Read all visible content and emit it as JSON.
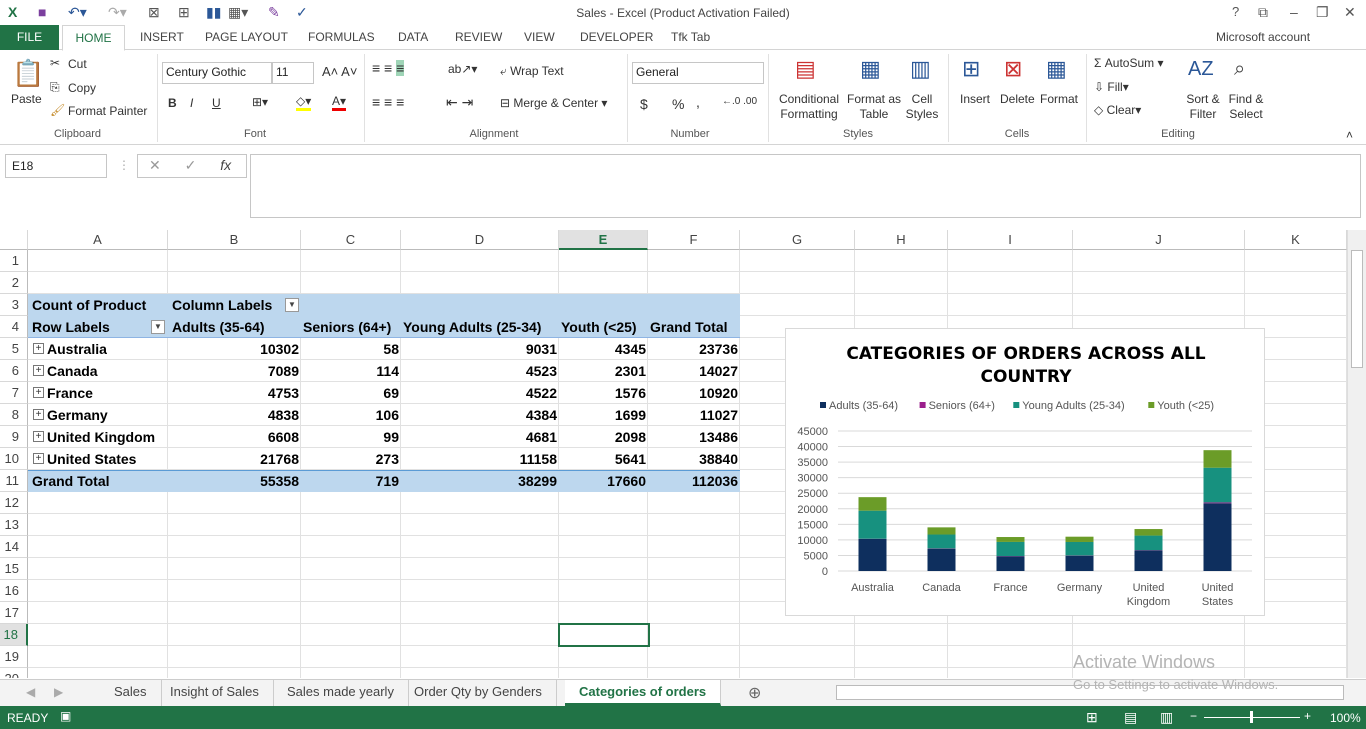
{
  "window": {
    "title": "Sales - Excel (Product Activation Failed)",
    "help": "?",
    "account": "Microsoft account"
  },
  "ribbon_tabs": [
    "FILE",
    "HOME",
    "INSERT",
    "PAGE LAYOUT",
    "FORMULAS",
    "DATA",
    "REVIEW",
    "VIEW",
    "DEVELOPER",
    "Tfk Tab"
  ],
  "ribbon": {
    "clipboard": {
      "paste": "Paste",
      "cut": "Cut",
      "copy": "Copy",
      "format_painter": "Format Painter",
      "label": "Clipboard"
    },
    "font": {
      "name": "Century Gothic",
      "size": "11",
      "bold": "B",
      "italic": "I",
      "underline": "U",
      "label": "Font"
    },
    "alignment": {
      "wrap": "Wrap Text",
      "merge": "Merge & Center",
      "label": "Alignment"
    },
    "number": {
      "format": "General",
      "currency": "$",
      "percent": "%",
      "comma": ",",
      "label": "Number"
    },
    "styles": {
      "conditional": "Conditional Formatting",
      "format_table": "Format as Table",
      "cell_styles": "Cell Styles",
      "label": "Styles"
    },
    "cells": {
      "insert": "Insert",
      "delete": "Delete",
      "format": "Format",
      "label": "Cells"
    },
    "editing": {
      "autosum": "AutoSum",
      "fill": "Fill",
      "clear": "Clear",
      "sort": "Sort & Filter",
      "find": "Find & Select",
      "label": "Editing"
    }
  },
  "formula_bar": {
    "name_box": "E18",
    "fx": "fx",
    "value": ""
  },
  "columns": [
    "A",
    "B",
    "C",
    "D",
    "E",
    "F",
    "G",
    "H",
    "I",
    "J",
    "K"
  ],
  "selected_column": "E",
  "selected_row": "18",
  "selected_cell": "E18",
  "rows": [
    "1",
    "2",
    "3",
    "4",
    "5",
    "6",
    "7",
    "8",
    "9",
    "10",
    "11",
    "12",
    "13",
    "14",
    "15",
    "16",
    "17",
    "18",
    "19",
    "20"
  ],
  "pivot": {
    "corner": "Count of Product",
    "col_labels": "Column Labels",
    "row_labels": "Row Labels",
    "headers": [
      "Adults (35-64)",
      "Seniors (64+)",
      "Young Adults (25-34)",
      "Youth (<25)",
      "Grand Total"
    ],
    "data": [
      [
        "Australia",
        "10302",
        "58",
        "9031",
        "4345",
        "23736"
      ],
      [
        "Canada",
        "7089",
        "114",
        "4523",
        "2301",
        "14027"
      ],
      [
        "France",
        "4753",
        "69",
        "4522",
        "1576",
        "10920"
      ],
      [
        "Germany",
        "4838",
        "106",
        "4384",
        "1699",
        "11027"
      ],
      [
        "United Kingdom",
        "6608",
        "99",
        "4681",
        "2098",
        "13486"
      ],
      [
        "United States",
        "21768",
        "273",
        "11158",
        "5641",
        "38840"
      ]
    ],
    "total": [
      "Grand Total",
      "55358",
      "719",
      "38299",
      "17660",
      "112036"
    ],
    "header_color": "#bdd7ee"
  },
  "chart_data": {
    "type": "bar",
    "stacked": true,
    "title": "CATEGORIES OF ORDERS ACROSS ALL COUNTRY",
    "categories": [
      "Australia",
      "Canada",
      "France",
      "Germany",
      "United Kingdom",
      "United States"
    ],
    "series": [
      {
        "name": "Adults (35-64)",
        "color": "#0e2f5e",
        "values": [
          10302,
          7089,
          4753,
          4838,
          6608,
          21768
        ]
      },
      {
        "name": "Seniors (64+)",
        "color": "#9b1f8c",
        "values": [
          58,
          114,
          69,
          106,
          99,
          273
        ]
      },
      {
        "name": "Young Adults (25-34)",
        "color": "#17917f",
        "values": [
          9031,
          4523,
          4522,
          4384,
          4681,
          11158
        ]
      },
      {
        "name": "Youth (<25)",
        "color": "#6b9c28",
        "values": [
          4345,
          2301,
          1576,
          1699,
          2098,
          5641
        ]
      }
    ],
    "yticks": [
      "0",
      "5000",
      "10000",
      "15000",
      "20000",
      "25000",
      "30000",
      "35000",
      "40000",
      "45000"
    ],
    "ylim": [
      0,
      45000
    ],
    "grid": true,
    "legend": "top"
  },
  "sheets": [
    "Sales",
    "Insight of Sales",
    "Sales made yearly",
    "Order Qty by Genders",
    "Categories of orders"
  ],
  "active_sheet": "Categories of orders",
  "watermark": {
    "line1": "Activate Windows",
    "line2": "Go to Settings to activate Windows."
  },
  "status": {
    "ready": "READY",
    "zoom": "100%"
  }
}
